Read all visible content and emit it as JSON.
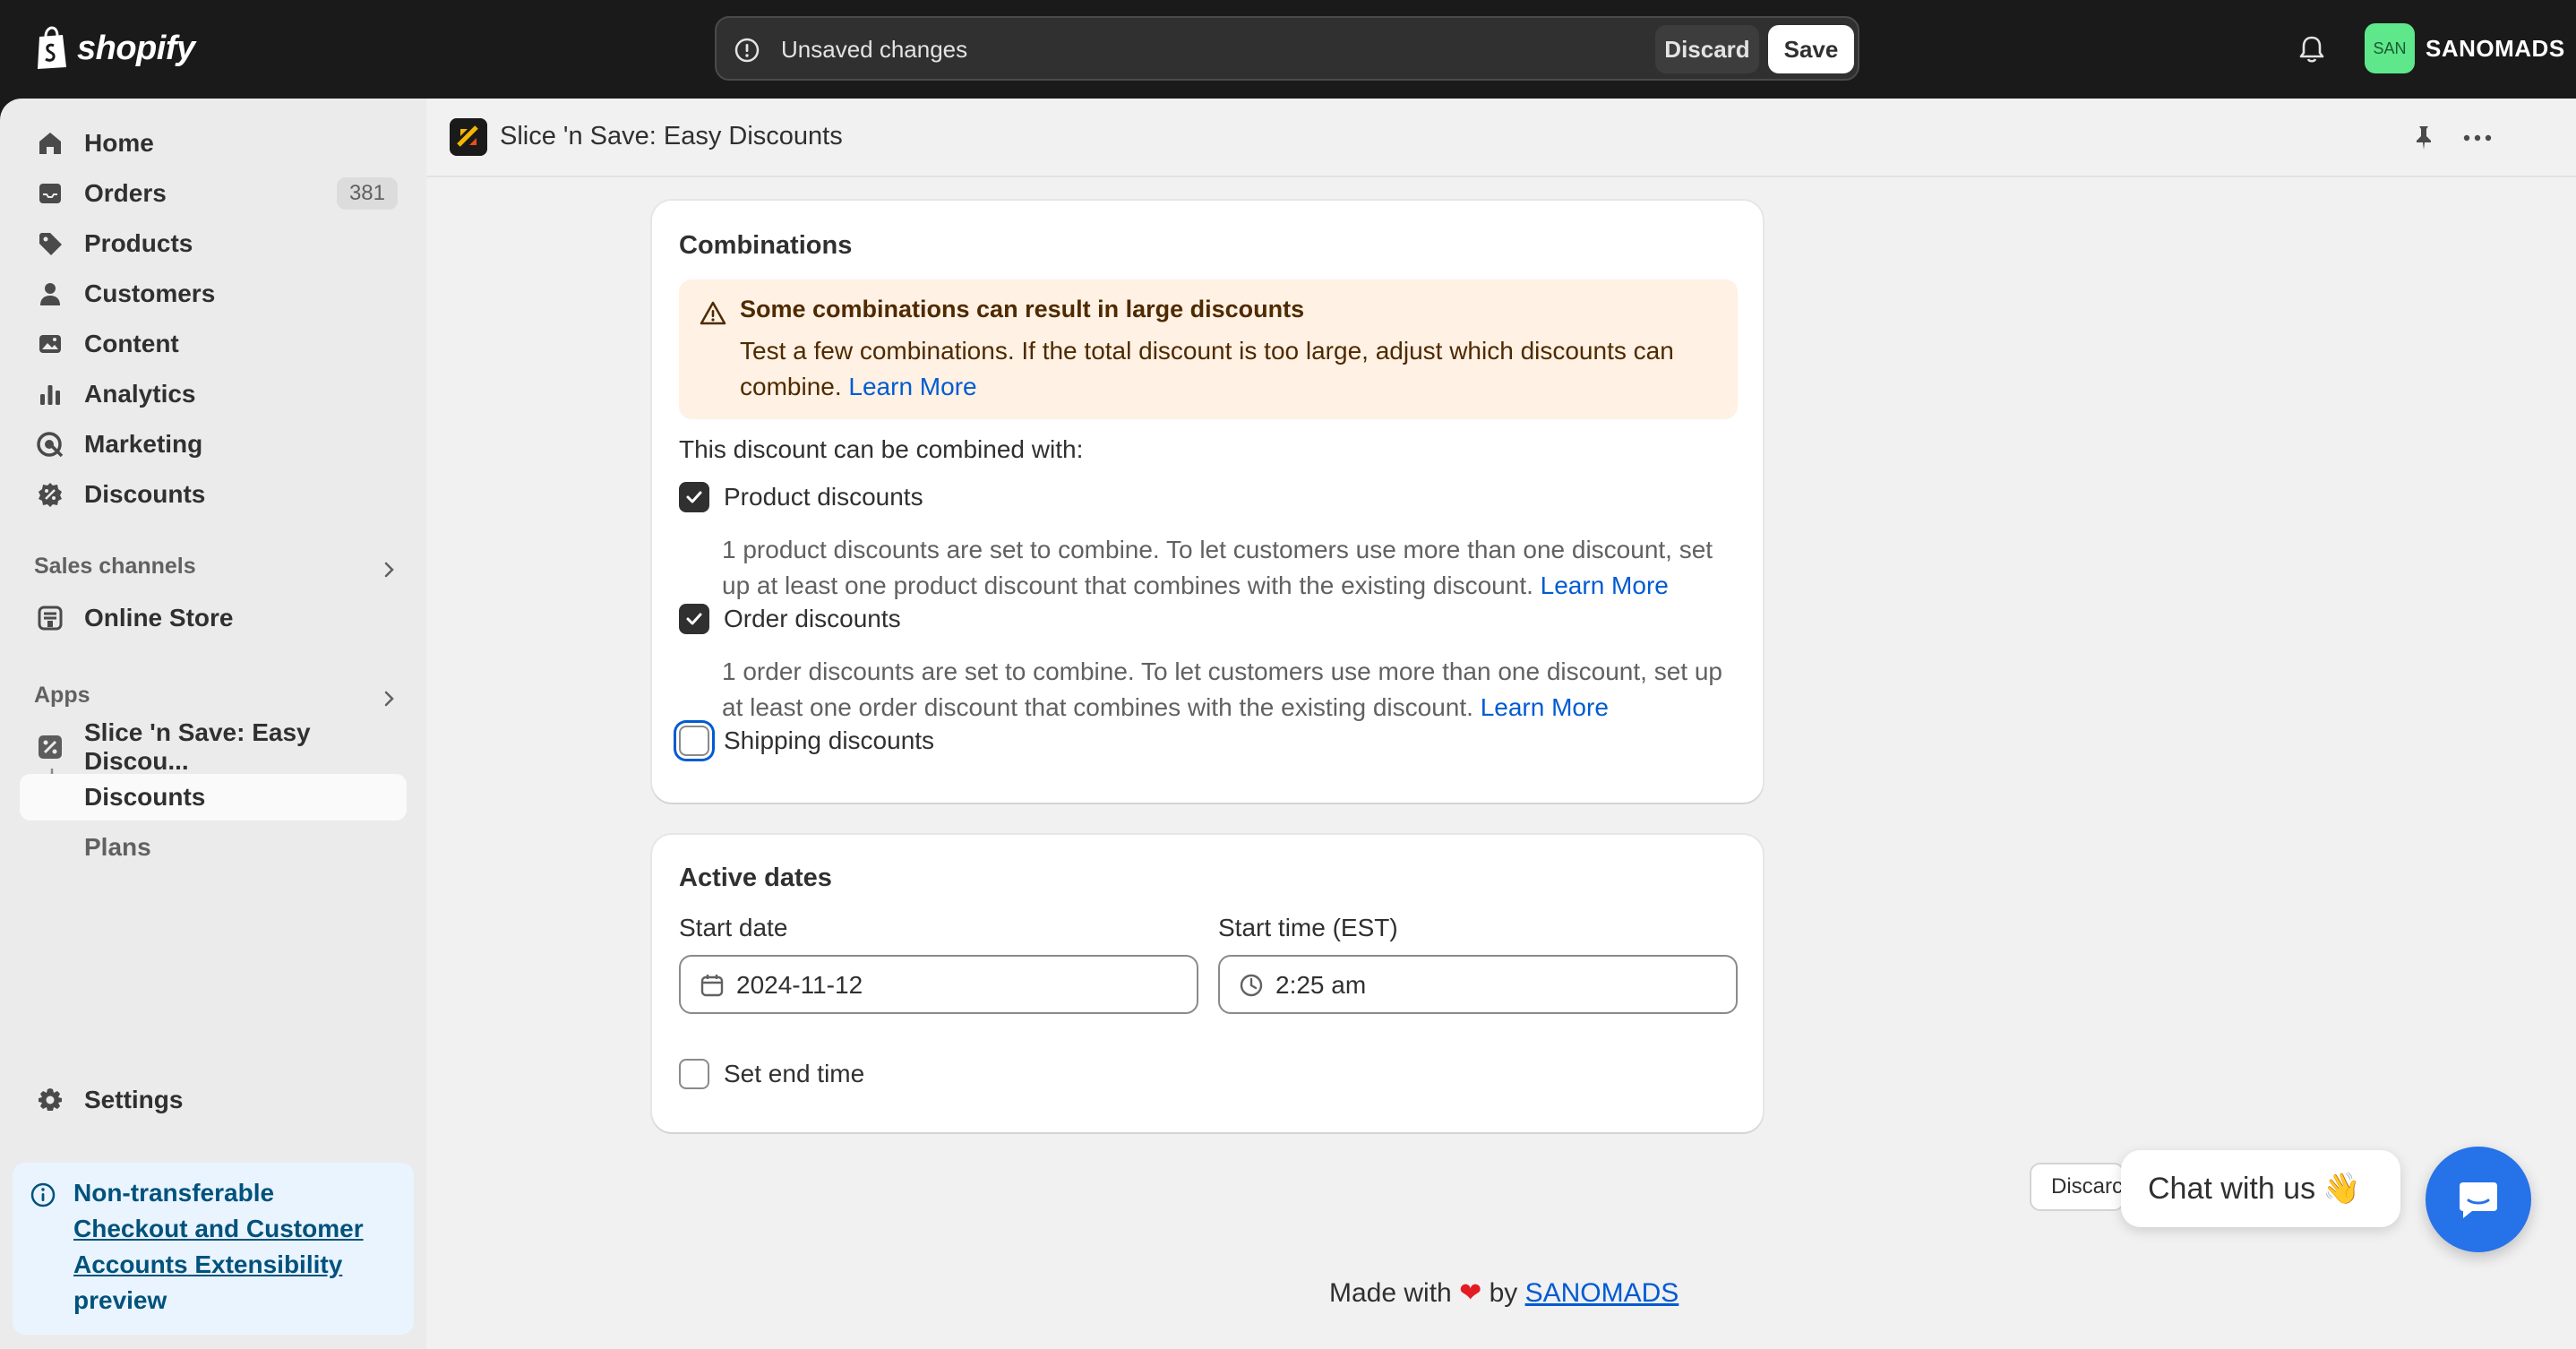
{
  "topbar": {
    "logo_text": "shopify",
    "unsaved_text": "Unsaved changes",
    "discard_label": "Discard",
    "save_label": "Save",
    "avatar_initials": "SAN",
    "store_name": "SANOMADS"
  },
  "sidebar": {
    "items": [
      {
        "label": "Home",
        "icon": "home-icon"
      },
      {
        "label": "Orders",
        "icon": "inbox-icon",
        "badge": "381"
      },
      {
        "label": "Products",
        "icon": "tag-icon"
      },
      {
        "label": "Customers",
        "icon": "person-icon"
      },
      {
        "label": "Content",
        "icon": "image-icon"
      },
      {
        "label": "Analytics",
        "icon": "bar-chart-icon"
      },
      {
        "label": "Marketing",
        "icon": "target-icon"
      },
      {
        "label": "Discounts",
        "icon": "discount-icon"
      }
    ],
    "sales_channels_label": "Sales channels",
    "online_store_label": "Online Store",
    "apps_label": "Apps",
    "app_name": "Slice 'n Save: Easy Discou...",
    "app_sub_discounts": "Discounts",
    "app_sub_plans": "Plans",
    "settings_label": "Settings",
    "notice": {
      "line1": "Non-transferable",
      "link": "Checkout and Customer Accounts Extensibility",
      "line3": "preview"
    }
  },
  "app_header": {
    "title": "Slice 'n Save: Easy Discounts"
  },
  "combinations": {
    "title": "Combinations",
    "banner_title": "Some combinations can result in large discounts",
    "banner_body": "Test a few combinations. If the total discount is too large, adjust which discounts can combine.",
    "banner_link": "Learn More",
    "intro": "This discount can be combined with:",
    "options": [
      {
        "label": "Product discounts",
        "checked": true,
        "help": "1 product discounts are set to combine. To let customers use more than one discount, set up at least one product discount that combines with the existing discount.",
        "link": "Learn More"
      },
      {
        "label": "Order discounts",
        "checked": true,
        "help": "1 order discounts are set to combine. To let customers use more than one discount, set up at least one order discount that combines with the existing discount.",
        "link": "Learn More"
      },
      {
        "label": "Shipping discounts",
        "checked": false
      }
    ]
  },
  "active_dates": {
    "title": "Active dates",
    "start_date_label": "Start date",
    "start_date_value": "2024-11-12",
    "start_time_label": "Start time (EST)",
    "start_time_value": "2:25 am",
    "end_time_label": "Set end time",
    "end_time_checked": false
  },
  "floating": {
    "discard_label": "Discarc",
    "chat_label": "Chat with us",
    "chat_emoji": "👋"
  },
  "footer": {
    "prefix": "Made with",
    "heart": "❤",
    "by": "by",
    "maker": "SANOMADS"
  },
  "colors": {
    "accent": "#005bd3",
    "topbar_bg": "#1a1a1a",
    "warning_bg": "#fff1e3",
    "chat_blue": "#2672e8"
  }
}
